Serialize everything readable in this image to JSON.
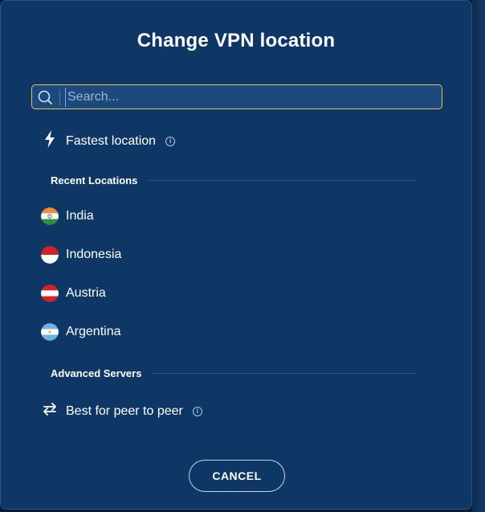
{
  "dialog": {
    "title": "Change VPN location"
  },
  "search": {
    "placeholder": "Search..."
  },
  "fastest": {
    "label": "Fastest location",
    "icon": "lightning-icon"
  },
  "recent": {
    "heading": "Recent Locations",
    "items": [
      {
        "label": "India",
        "icon": "india-flag-icon"
      },
      {
        "label": "Indonesia",
        "icon": "indonesia-flag-icon"
      },
      {
        "label": "Austria",
        "icon": "austria-flag-icon"
      },
      {
        "label": "Argentina",
        "icon": "argentina-flag-icon"
      }
    ]
  },
  "advanced": {
    "heading": "Advanced Servers",
    "items": [
      {
        "label": "Best for peer to peer",
        "icon": "arrows-exchange-icon"
      }
    ]
  },
  "footer": {
    "cancel_label": "CANCEL"
  },
  "colors": {
    "background": "#0f3766",
    "search_border": "#e9c15a",
    "text": "#ffffff"
  }
}
